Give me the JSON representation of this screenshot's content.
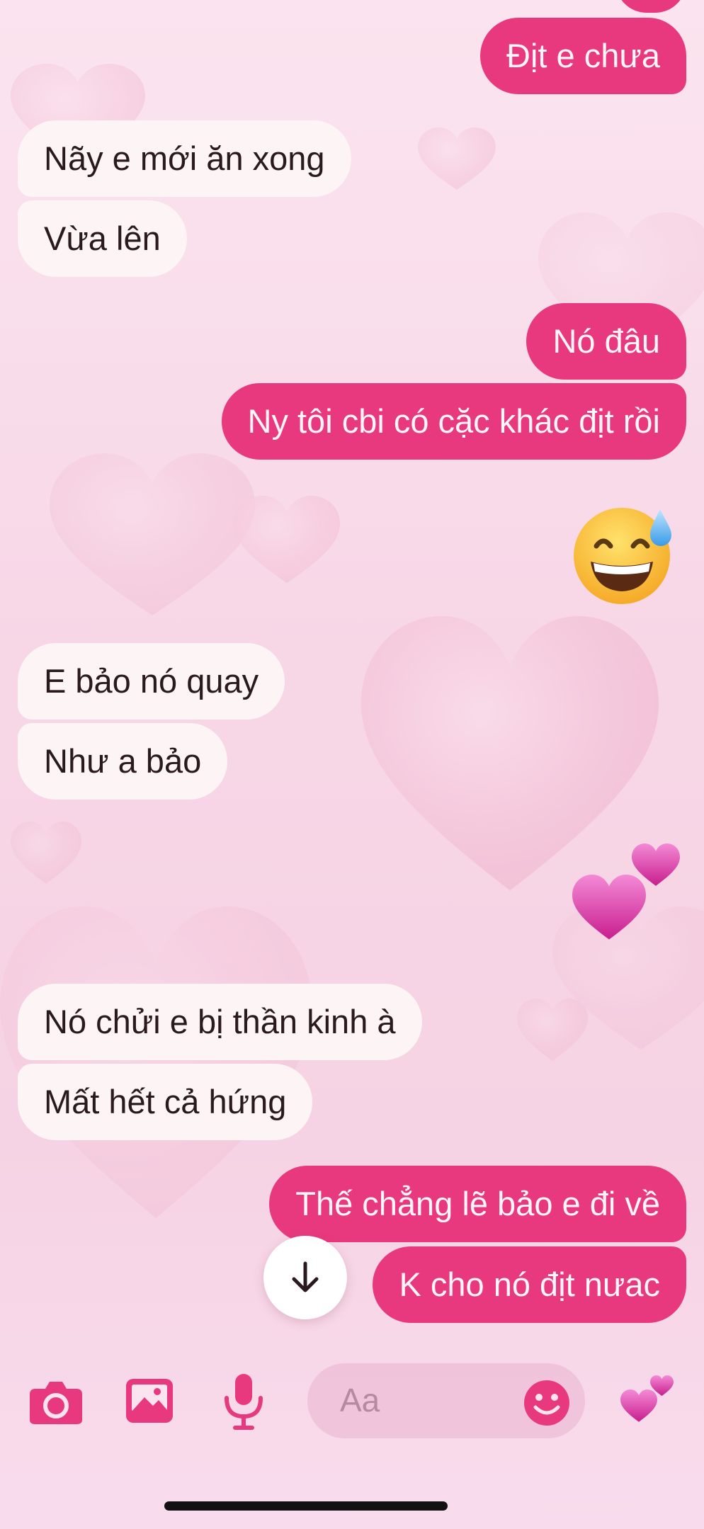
{
  "messages": [
    {
      "id": "m1",
      "side": "out",
      "text": "Địt e chưa"
    },
    {
      "id": "m2",
      "side": "in",
      "text": "Nãy e mới ăn xong"
    },
    {
      "id": "m3",
      "side": "in",
      "text": "Vừa lên"
    },
    {
      "id": "m4",
      "side": "out",
      "text": "Nó đâu"
    },
    {
      "id": "m5",
      "side": "out",
      "text": "Ny tôi cbi có cặc khác địt rồi"
    },
    {
      "id": "m6",
      "side": "out",
      "emoji": "grinning-face-with-sweat"
    },
    {
      "id": "m7",
      "side": "in",
      "text": "E bảo nó quay"
    },
    {
      "id": "m8",
      "side": "in",
      "text": "Như a bảo"
    },
    {
      "id": "m9",
      "side": "out",
      "emoji": "two-hearts"
    },
    {
      "id": "m10",
      "side": "in",
      "text": "Nó chửi e bị thần kinh à"
    },
    {
      "id": "m11",
      "side": "in",
      "text": "Mất hết cả hứng"
    },
    {
      "id": "m12",
      "side": "out",
      "text": "Thế chẳng lẽ bảo e đi về"
    },
    {
      "id": "m13",
      "side": "out",
      "text": "K cho nó địt nưac"
    }
  ],
  "composer": {
    "placeholder": "Aa",
    "icons": [
      "camera-icon",
      "image-icon",
      "microphone-icon",
      "smiley-icon",
      "two-hearts-icon"
    ]
  },
  "scroll_down_icon": "arrow-down-icon",
  "colors": {
    "accent": "#e8387e",
    "incoming_bubble": "#fdf5f5",
    "background": "#f7d6e6"
  }
}
